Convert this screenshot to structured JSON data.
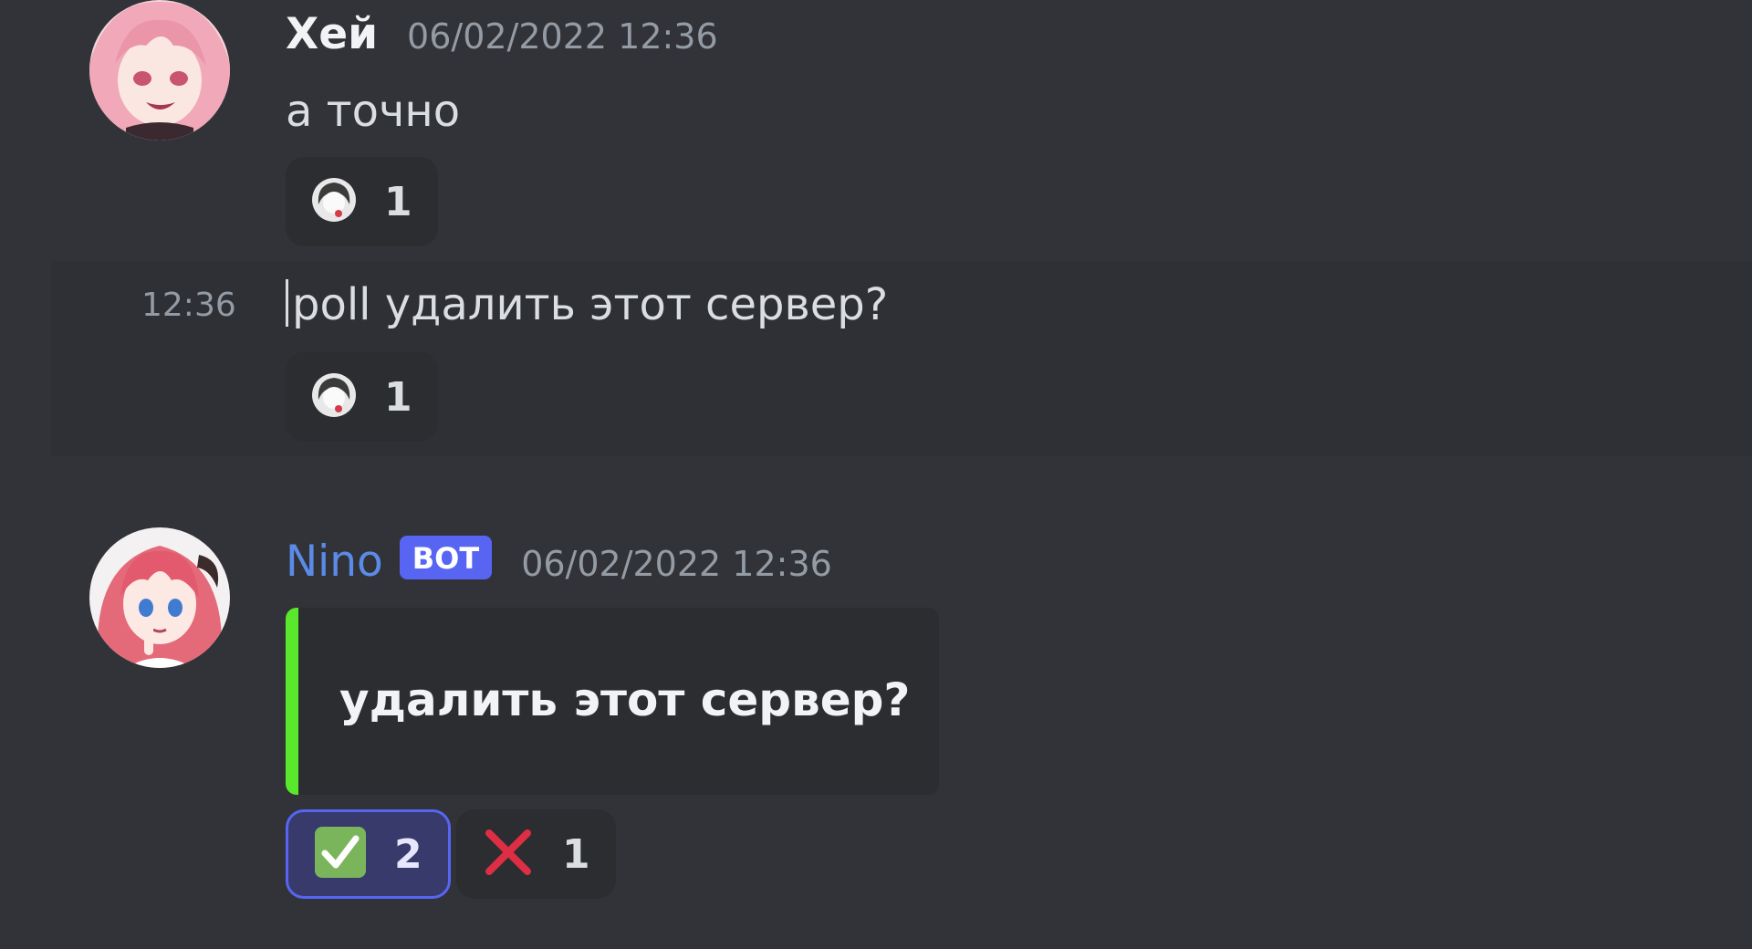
{
  "messages": [
    {
      "author": "Хей",
      "timestamp": "06/02/2022 12:36",
      "content": "а точно",
      "reactions": [
        {
          "icon": "custom-avatar-emoji",
          "count": "1"
        }
      ]
    },
    {
      "inline_time": "12:36",
      "content": "poll удалить этот сервер?",
      "reactions": [
        {
          "icon": "custom-avatar-emoji",
          "count": "1"
        }
      ]
    },
    {
      "author": "Nino",
      "bot_tag": "BOT",
      "timestamp": "06/02/2022 12:36",
      "embed": {
        "title": "удалить этот сервер?",
        "accent_color": "#5ae82c"
      },
      "reactions": [
        {
          "icon": "check-mark-icon",
          "count": "2",
          "selected": true
        },
        {
          "icon": "cross-mark-icon",
          "count": "1",
          "selected": false
        }
      ]
    }
  ],
  "colors": {
    "background": "#313338",
    "hover_row": "#2e3035",
    "bot_name": "#5b8be8",
    "bot_tag": "#5865f2",
    "selected_reaction_border": "#5865f2"
  }
}
